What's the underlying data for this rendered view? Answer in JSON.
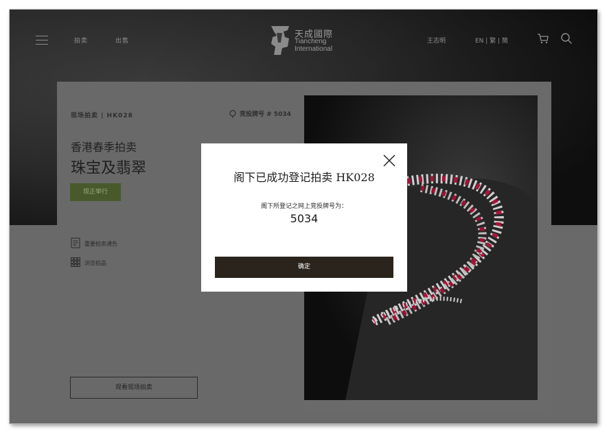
{
  "nav": {
    "menu_icon": "hamburger-icon",
    "links": [
      "拍卖",
      "出售"
    ],
    "logo": {
      "chinese": "天成國際",
      "english_line1": "Tiancheng",
      "english_line2": "International"
    },
    "user_name": "王志明",
    "languages": "EN | 繁 | 簡",
    "cart_icon": "cart-icon",
    "search_icon": "search-icon"
  },
  "sale": {
    "code_line": "现场拍卖 | HK028",
    "paddle_label": "竞投牌号 # 5034",
    "location": "香港春季拍卖",
    "title": "珠宝及翡翠",
    "status": "现正举行",
    "links": [
      {
        "icon": "document-icon",
        "label": "重要拍卖通告"
      },
      {
        "icon": "grid-icon",
        "label": "浏览拍品"
      }
    ],
    "watch_button": "观看现场拍卖"
  },
  "modal": {
    "title_prefix": "阁下已成功登记拍卖",
    "title_code": "HK028",
    "label": "阁下所登记之网上竞投牌号为：",
    "paddle_number": "5034",
    "confirm_button": "确定",
    "close_icon": "close-icon"
  },
  "colors": {
    "header_bg": "#1c1c1c",
    "status_green": "#485a2c",
    "confirm_bg": "#2b241d"
  }
}
